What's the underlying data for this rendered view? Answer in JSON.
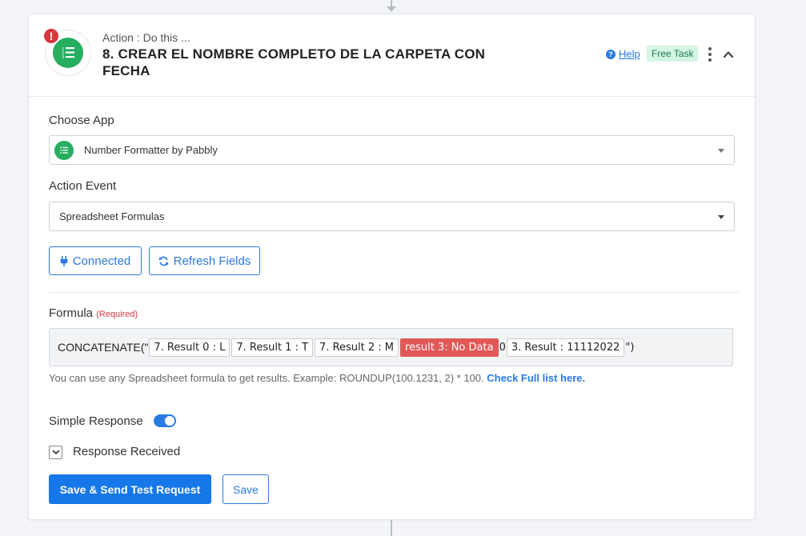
{
  "header": {
    "subtitle": "Action : Do this ...",
    "title": "8. CREAR EL NOMBRE COMPLETO DE LA CARPETA CON FECHA",
    "alert_symbol": "!",
    "help_label": "Help",
    "help_icon_symbol": "?",
    "free_task_label": "Free Task"
  },
  "choose_app": {
    "label": "Choose App",
    "selected": "Number Formatter by Pabbly"
  },
  "action_event": {
    "label": "Action Event",
    "selected": "Spreadsheet Formulas"
  },
  "buttons": {
    "connected": "Connected",
    "refresh": "Refresh Fields",
    "save_send": "Save & Send Test Request",
    "save": "Save"
  },
  "formula": {
    "label": "Formula",
    "required": "(Required)",
    "prefix": "CONCATENATE(\"",
    "tokens": [
      "7. Result 0 : L",
      "7. Result 1 : T",
      "7. Result 2 : M",
      "result 3: No Data"
    ],
    "separator": "0",
    "last_token": "3. Result : 11112022",
    "suffix": "\")"
  },
  "help_text": {
    "main": "You can use any Spreadsheet formula to get results. Example: ROUNDUP(100.1231, 2) * 100.",
    "link": "Check Full list here."
  },
  "options": {
    "simple_response": "Simple Response",
    "simple_response_on": true,
    "response_received": "Response Received"
  },
  "colors": {
    "primary": "#1677e8",
    "app_green": "#27ae60",
    "error_red": "#e15858",
    "badge_green_bg": "#d4f5e2"
  },
  "icons": {
    "app": "number-formatter-icon",
    "alert": "alert-icon",
    "help": "help-circle-icon",
    "kebab": "more-vertical-icon",
    "collapse": "chevron-up-icon",
    "connected": "plug-icon",
    "refresh": "refresh-icon",
    "dropdown": "caret-down-icon",
    "checkbox": "chevron-down-icon"
  }
}
